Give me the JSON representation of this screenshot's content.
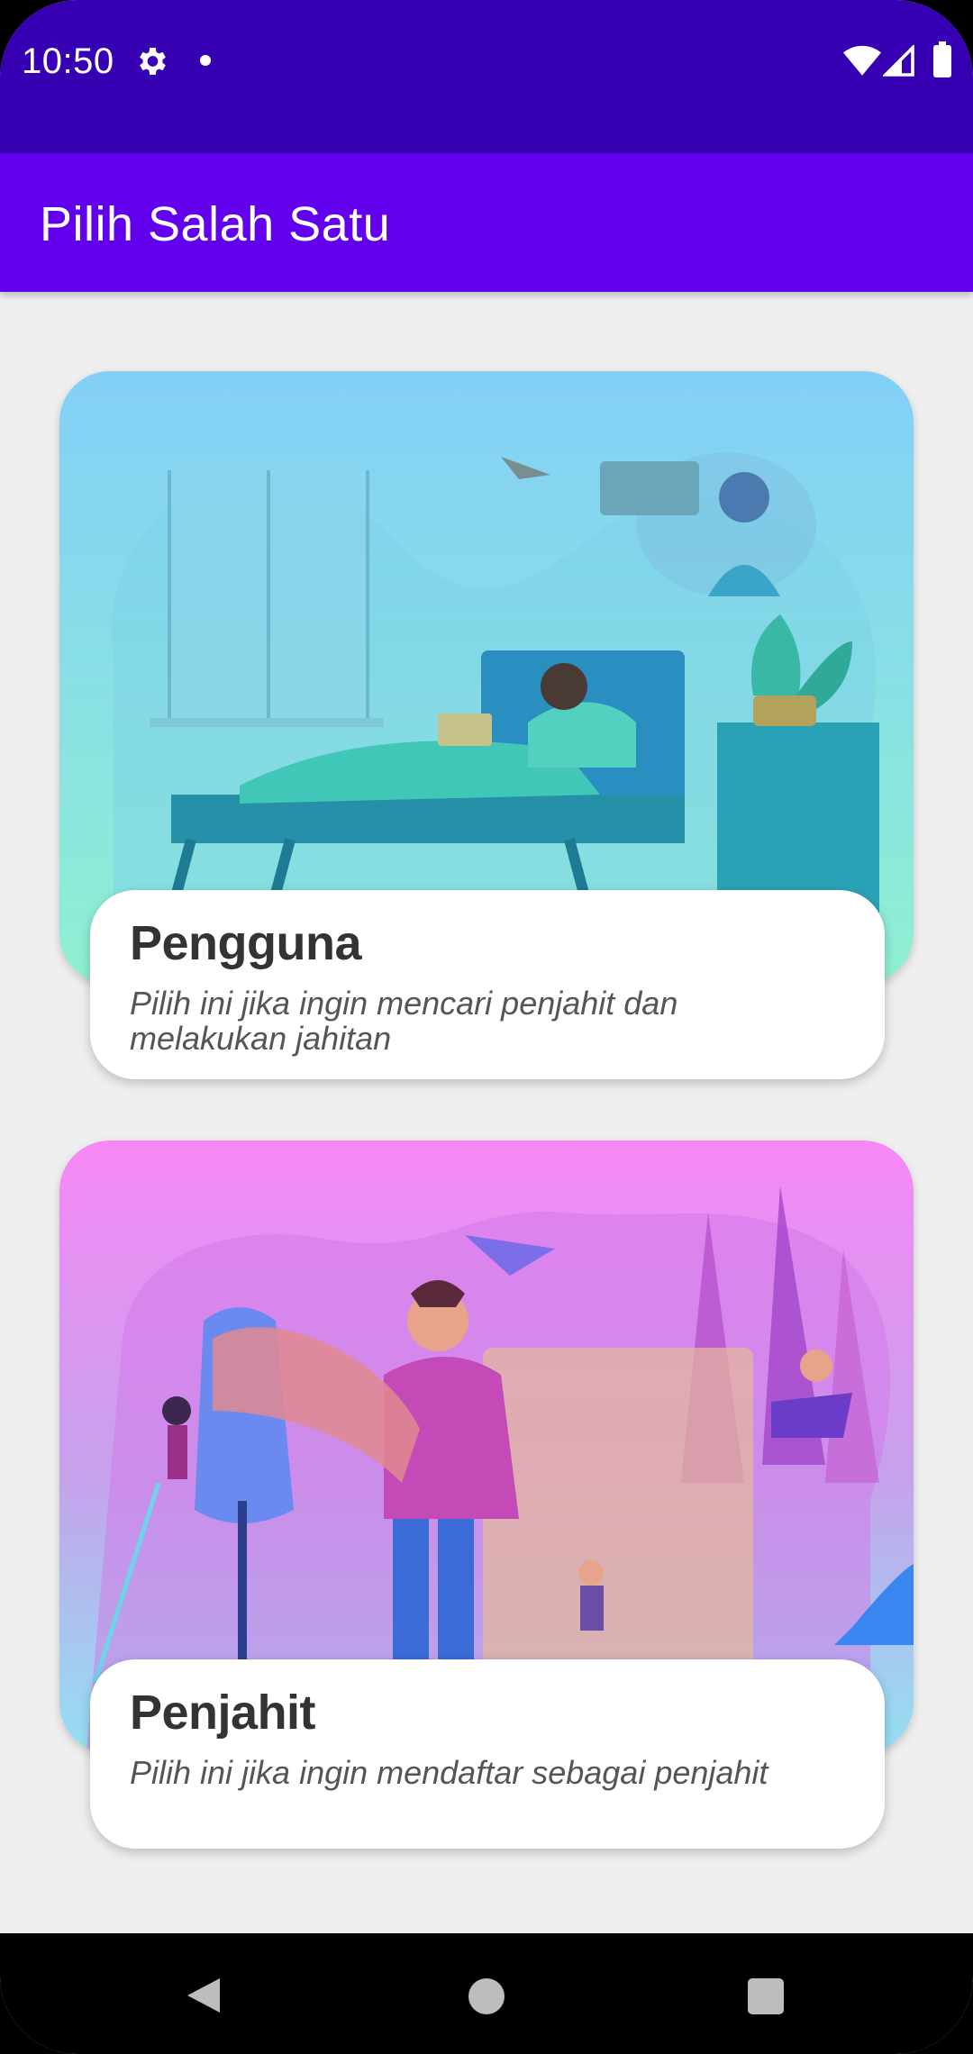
{
  "status_bar": {
    "time": "10:50",
    "icons": [
      "gear-icon",
      "dot-icon",
      "wifi-icon",
      "signal-icon",
      "battery-icon"
    ]
  },
  "toolbar": {
    "title": "Pilih Salah Satu"
  },
  "cards": [
    {
      "title": "Pengguna",
      "description": "Pilih ini jika ingin mencari penjahit dan melakukan jahitan",
      "image": "person-relaxing-bed-illustration"
    },
    {
      "title": "Penjahit",
      "description": "Pilih ini jika ingin mendaftar sebagai penjahit",
      "image": "tailors-sewing-illustration"
    }
  ],
  "nav_bar": {
    "icons": [
      "back-icon",
      "home-icon",
      "recents-icon"
    ]
  },
  "colors": {
    "status_bar": "#3700b3",
    "toolbar": "#6200ee",
    "background": "#efefef"
  }
}
